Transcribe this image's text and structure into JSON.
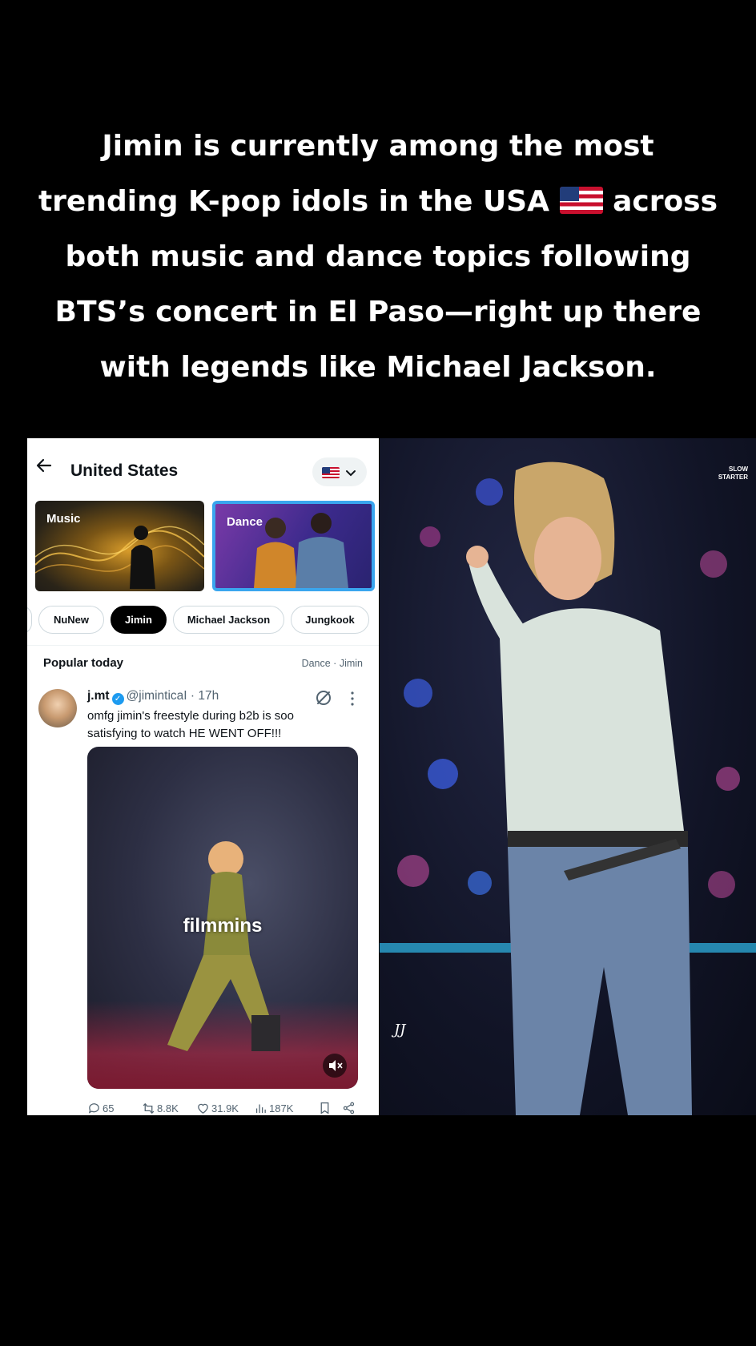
{
  "caption": {
    "line1": "Jimin is currently among the most",
    "line2a": "trending K-pop idols in the USA",
    "line2b": "across",
    "line3": "both music and dance topics following",
    "line4": "BTS’s concert in El Paso—right up there",
    "line5": "with legends like Michael Jackson."
  },
  "header": {
    "title": "United States"
  },
  "topics": [
    {
      "label": "Music"
    },
    {
      "label": "Dance"
    }
  ],
  "chips": [
    {
      "label": "NuNew"
    },
    {
      "label": "Jimin"
    },
    {
      "label": "Michael Jackson"
    },
    {
      "label": "Jungkook"
    }
  ],
  "section": {
    "title": "Popular today",
    "meta": "Dance · Jimin"
  },
  "post": {
    "name": "j.mt",
    "handle": "@jiminticaI · 17h",
    "text": "omfg jimin's freestyle during b2b is soo satisfying to watch HE WENT OFF!!!",
    "media_watermark": "filmmins",
    "replies": "65",
    "reposts": "8.8K",
    "likes": "31.9K",
    "views": "187K"
  },
  "photo": {
    "brand_line1": "SLOW",
    "brand_line2": "STARTER",
    "signature": "JJ"
  },
  "colors": {
    "accent": "#1d9bf0",
    "selected_border": "#3aa6ee"
  }
}
